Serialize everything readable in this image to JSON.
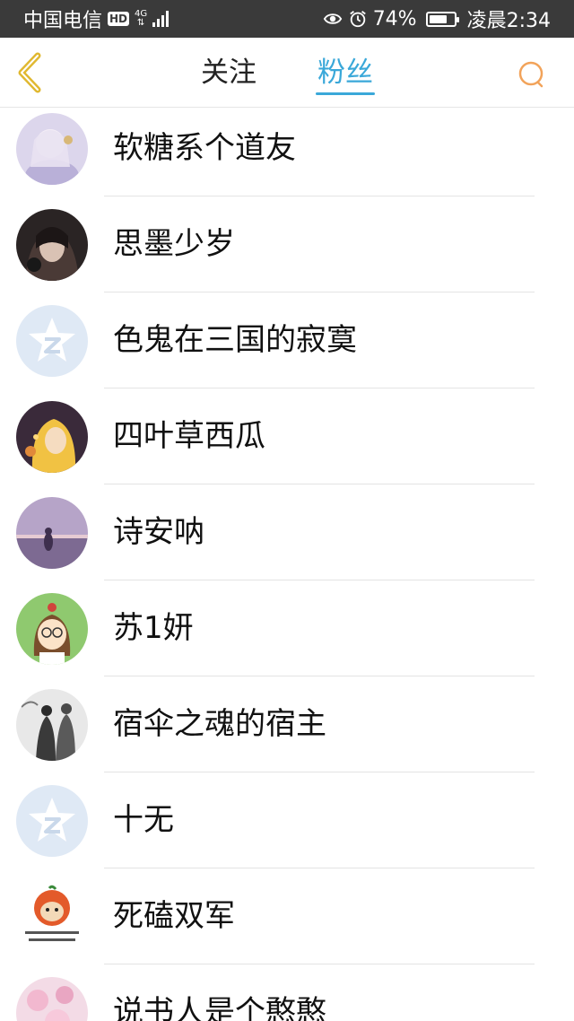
{
  "status_bar": {
    "carrier": "中国电信",
    "hd": "HD",
    "network": "4G",
    "battery": "74%",
    "battery_level": 0.74,
    "time": "凌晨2:34"
  },
  "header": {
    "tabs": [
      {
        "label": "关注",
        "active": false
      },
      {
        "label": "粉丝",
        "active": true
      }
    ],
    "accent_color": "#3aa8d9",
    "back_icon": "chevron-left-icon",
    "search_icon": "search-icon"
  },
  "fans": [
    {
      "name": "软糖系个道友",
      "avatar": "anime-girl-pale"
    },
    {
      "name": "思墨少岁",
      "avatar": "dark-portrait"
    },
    {
      "name": "色鬼在三国的寂寞",
      "avatar": "default-qq-star"
    },
    {
      "name": "四叶草西瓜",
      "avatar": "anime-blonde"
    },
    {
      "name": "诗安呐",
      "avatar": "sunset-silhouette"
    },
    {
      "name": "苏1妍",
      "avatar": "cartoon-girl-glasses"
    },
    {
      "name": "宿伞之魂的宿主",
      "avatar": "ink-figures"
    },
    {
      "name": "十无",
      "avatar": "default-qq-star"
    },
    {
      "name": "死磕双军",
      "avatar": "shiba-dog"
    },
    {
      "name": "说书人是个憨憨",
      "avatar": "pink-blossom"
    }
  ]
}
